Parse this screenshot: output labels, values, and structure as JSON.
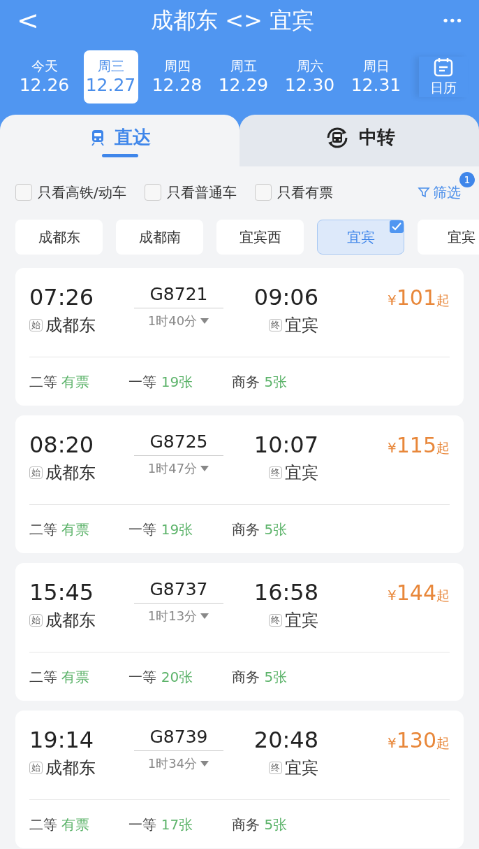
{
  "header": {
    "back": "<",
    "title": "成都东 <> 宜宾",
    "more": "•••"
  },
  "dates": [
    {
      "weekday": "今天",
      "date": "12.26",
      "selected": false
    },
    {
      "weekday": "周三",
      "date": "12.27",
      "selected": true
    },
    {
      "weekday": "周四",
      "date": "12.28",
      "selected": false
    },
    {
      "weekday": "周五",
      "date": "12.29",
      "selected": false
    },
    {
      "weekday": "周六",
      "date": "12.30",
      "selected": false
    },
    {
      "weekday": "周日",
      "date": "12.31",
      "selected": false
    }
  ],
  "calendar": {
    "label": "日历"
  },
  "tabs": [
    {
      "label": "直达",
      "selected": true,
      "kind": "direct"
    },
    {
      "label": "中转",
      "selected": false,
      "kind": "transfer"
    }
  ],
  "filters": [
    {
      "label": "只看高铁/动车",
      "checked": false
    },
    {
      "label": "只看普通车",
      "checked": false
    },
    {
      "label": "只看有票",
      "checked": false
    }
  ],
  "filter_button": {
    "label": "筛选",
    "badge": "1"
  },
  "stations": [
    {
      "label": "成都东",
      "selected": false
    },
    {
      "label": "成都南",
      "selected": false
    },
    {
      "label": "宜宾西",
      "selected": false
    },
    {
      "label": "宜宾",
      "selected": true
    },
    {
      "label": "宜宾",
      "selected": false
    }
  ],
  "trains": [
    {
      "depart_time": "07:26",
      "train_no": "G8721",
      "arrive_time": "09:06",
      "origin_tag": "始",
      "from": "成都东",
      "duration": "1时40分",
      "dest_tag": "终",
      "to": "宜宾",
      "price_symbol": "¥",
      "price": "101",
      "price_suffix": "起",
      "seats": [
        {
          "class": "二等",
          "availability": "有票"
        },
        {
          "class": "一等",
          "availability": "19张"
        },
        {
          "class": "商务",
          "availability": "5张"
        }
      ]
    },
    {
      "depart_time": "08:20",
      "train_no": "G8725",
      "arrive_time": "10:07",
      "origin_tag": "始",
      "from": "成都东",
      "duration": "1时47分",
      "dest_tag": "终",
      "to": "宜宾",
      "price_symbol": "¥",
      "price": "115",
      "price_suffix": "起",
      "seats": [
        {
          "class": "二等",
          "availability": "有票"
        },
        {
          "class": "一等",
          "availability": "19张"
        },
        {
          "class": "商务",
          "availability": "5张"
        }
      ]
    },
    {
      "depart_time": "15:45",
      "train_no": "G8737",
      "arrive_time": "16:58",
      "origin_tag": "始",
      "from": "成都东",
      "duration": "1时13分",
      "dest_tag": "终",
      "to": "宜宾",
      "price_symbol": "¥",
      "price": "144",
      "price_suffix": "起",
      "seats": [
        {
          "class": "二等",
          "availability": "有票"
        },
        {
          "class": "一等",
          "availability": "20张"
        },
        {
          "class": "商务",
          "availability": "5张"
        }
      ]
    },
    {
      "depart_time": "19:14",
      "train_no": "G8739",
      "arrive_time": "20:48",
      "origin_tag": "始",
      "from": "成都东",
      "duration": "1时34分",
      "dest_tag": "终",
      "to": "宜宾",
      "price_symbol": "¥",
      "price": "130",
      "price_suffix": "起",
      "seats": [
        {
          "class": "二等",
          "availability": "有票"
        },
        {
          "class": "一等",
          "availability": "17张"
        },
        {
          "class": "商务",
          "availability": "5张"
        }
      ]
    }
  ]
}
